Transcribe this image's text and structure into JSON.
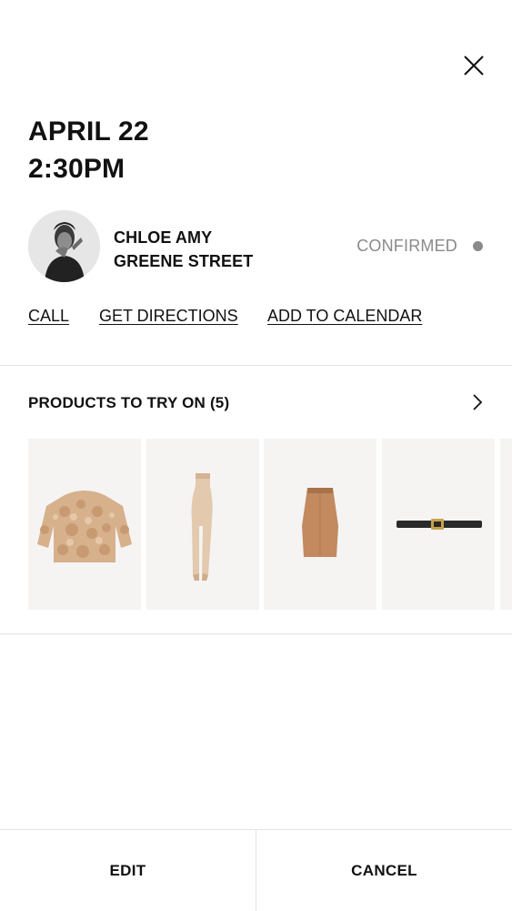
{
  "appointment": {
    "date": "APRIL 22",
    "time": "2:30PM"
  },
  "client": {
    "name": "CHLOE AMY",
    "location": "GREENE STREET",
    "status": "CONFIRMED",
    "status_color": "#8a8a8a"
  },
  "actions": {
    "call": "CALL",
    "directions": "GET DIRECTIONS",
    "calendar": "ADD TO CALENDAR"
  },
  "products": {
    "title": "PRODUCTS TO TRY ON (5)",
    "items": [
      {
        "icon": "fur-jacket-icon"
      },
      {
        "icon": "sheer-tights-icon"
      },
      {
        "icon": "pencil-skirt-icon"
      },
      {
        "icon": "leather-belt-icon"
      },
      {
        "icon": "product-image"
      }
    ]
  },
  "footer": {
    "edit": "EDIT",
    "cancel": "CANCEL"
  },
  "icons": {
    "close": "close-icon",
    "chevron": "chevron-right-icon",
    "avatar": "client-avatar"
  }
}
